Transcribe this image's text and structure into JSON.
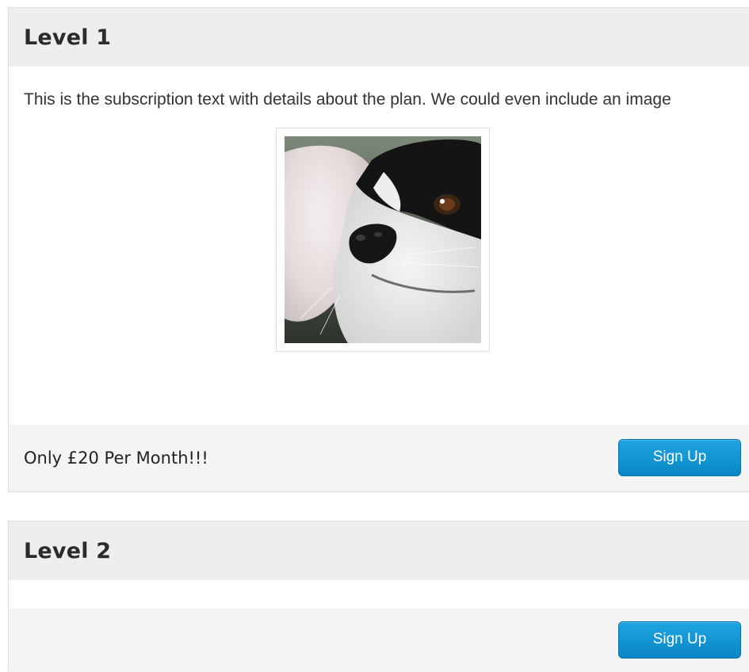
{
  "plans": [
    {
      "title": "Level 1",
      "description": "This is the subscription text with details about the plan. We could even include an image",
      "price_text": "Only £20 Per Month!!!",
      "button_label": "Sign Up"
    },
    {
      "title": "Level 2",
      "description": "",
      "price_text": "",
      "button_label": "Sign Up"
    }
  ],
  "colors": {
    "header_bg": "#eeeeee",
    "footer_bg": "#f4f4f4",
    "button_accent": "#0a86c4"
  }
}
